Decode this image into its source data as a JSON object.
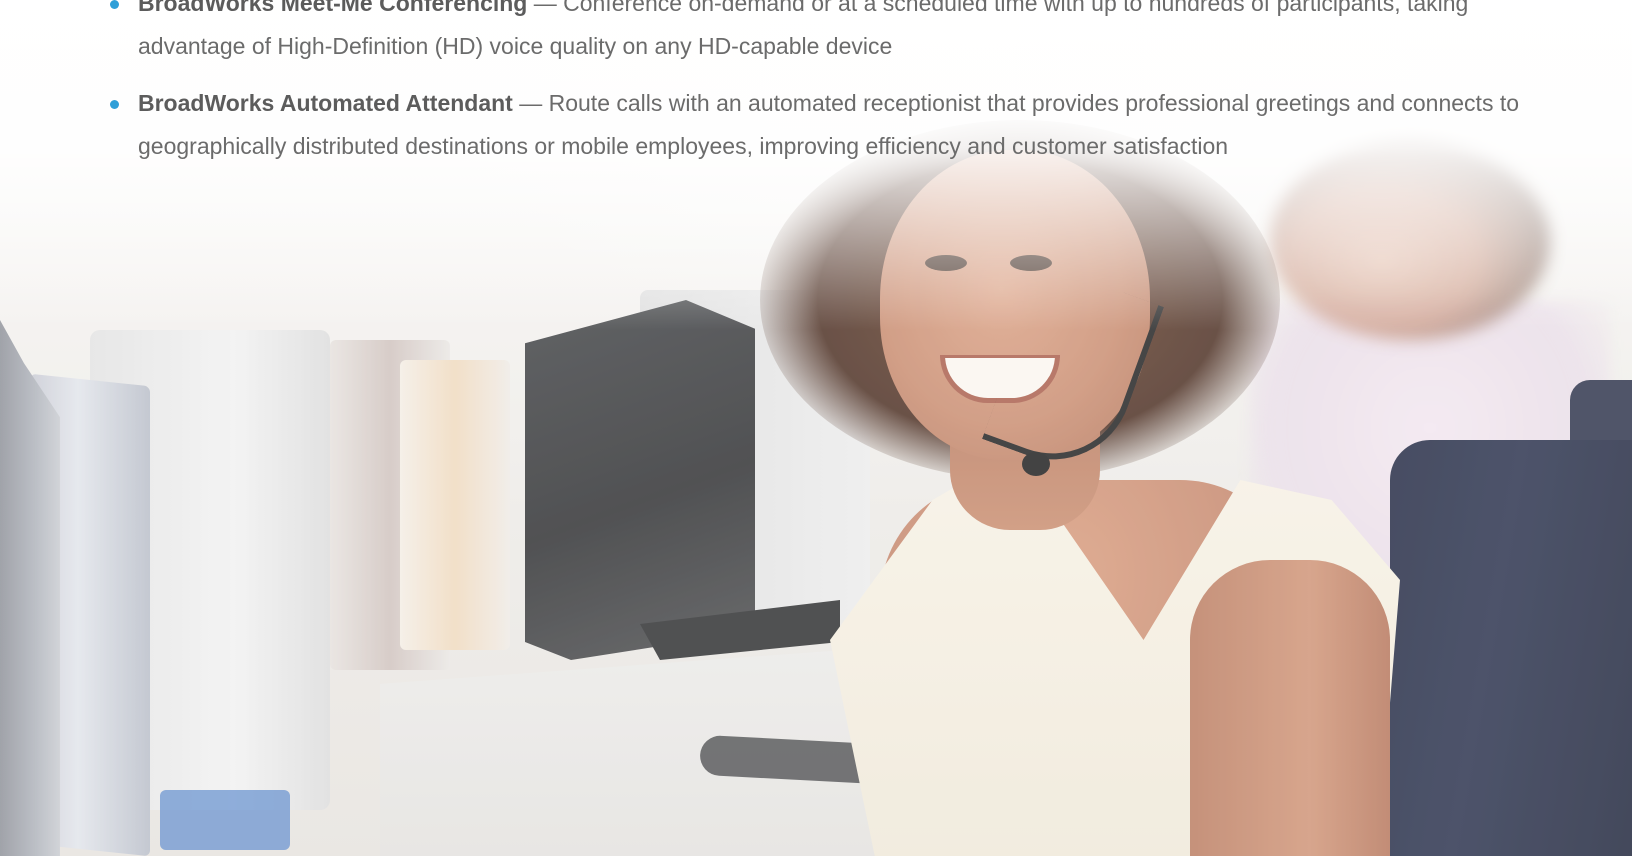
{
  "bullets": [
    {
      "title": "BroadWorks Meet-Me Conferencing",
      "separator": " — ",
      "text": "Conference on-demand or at a scheduled time with up to hundreds of participants, taking advantage of High-Definition (HD) voice quality on any HD-capable device"
    },
    {
      "title": "BroadWorks Automated Attendant",
      "separator": " — ",
      "text": "Route calls with an automated receptionist that provides professional greetings and connects to geographically distributed destinations or mobile employees, improving efficiency and customer satisfaction"
    }
  ],
  "colors": {
    "bullet": "#2f9fd8",
    "body_text": "#6b6b6b",
    "title_text": "#5c5c5c"
  },
  "icons": {
    "bullet": "bullet-dot-icon"
  }
}
